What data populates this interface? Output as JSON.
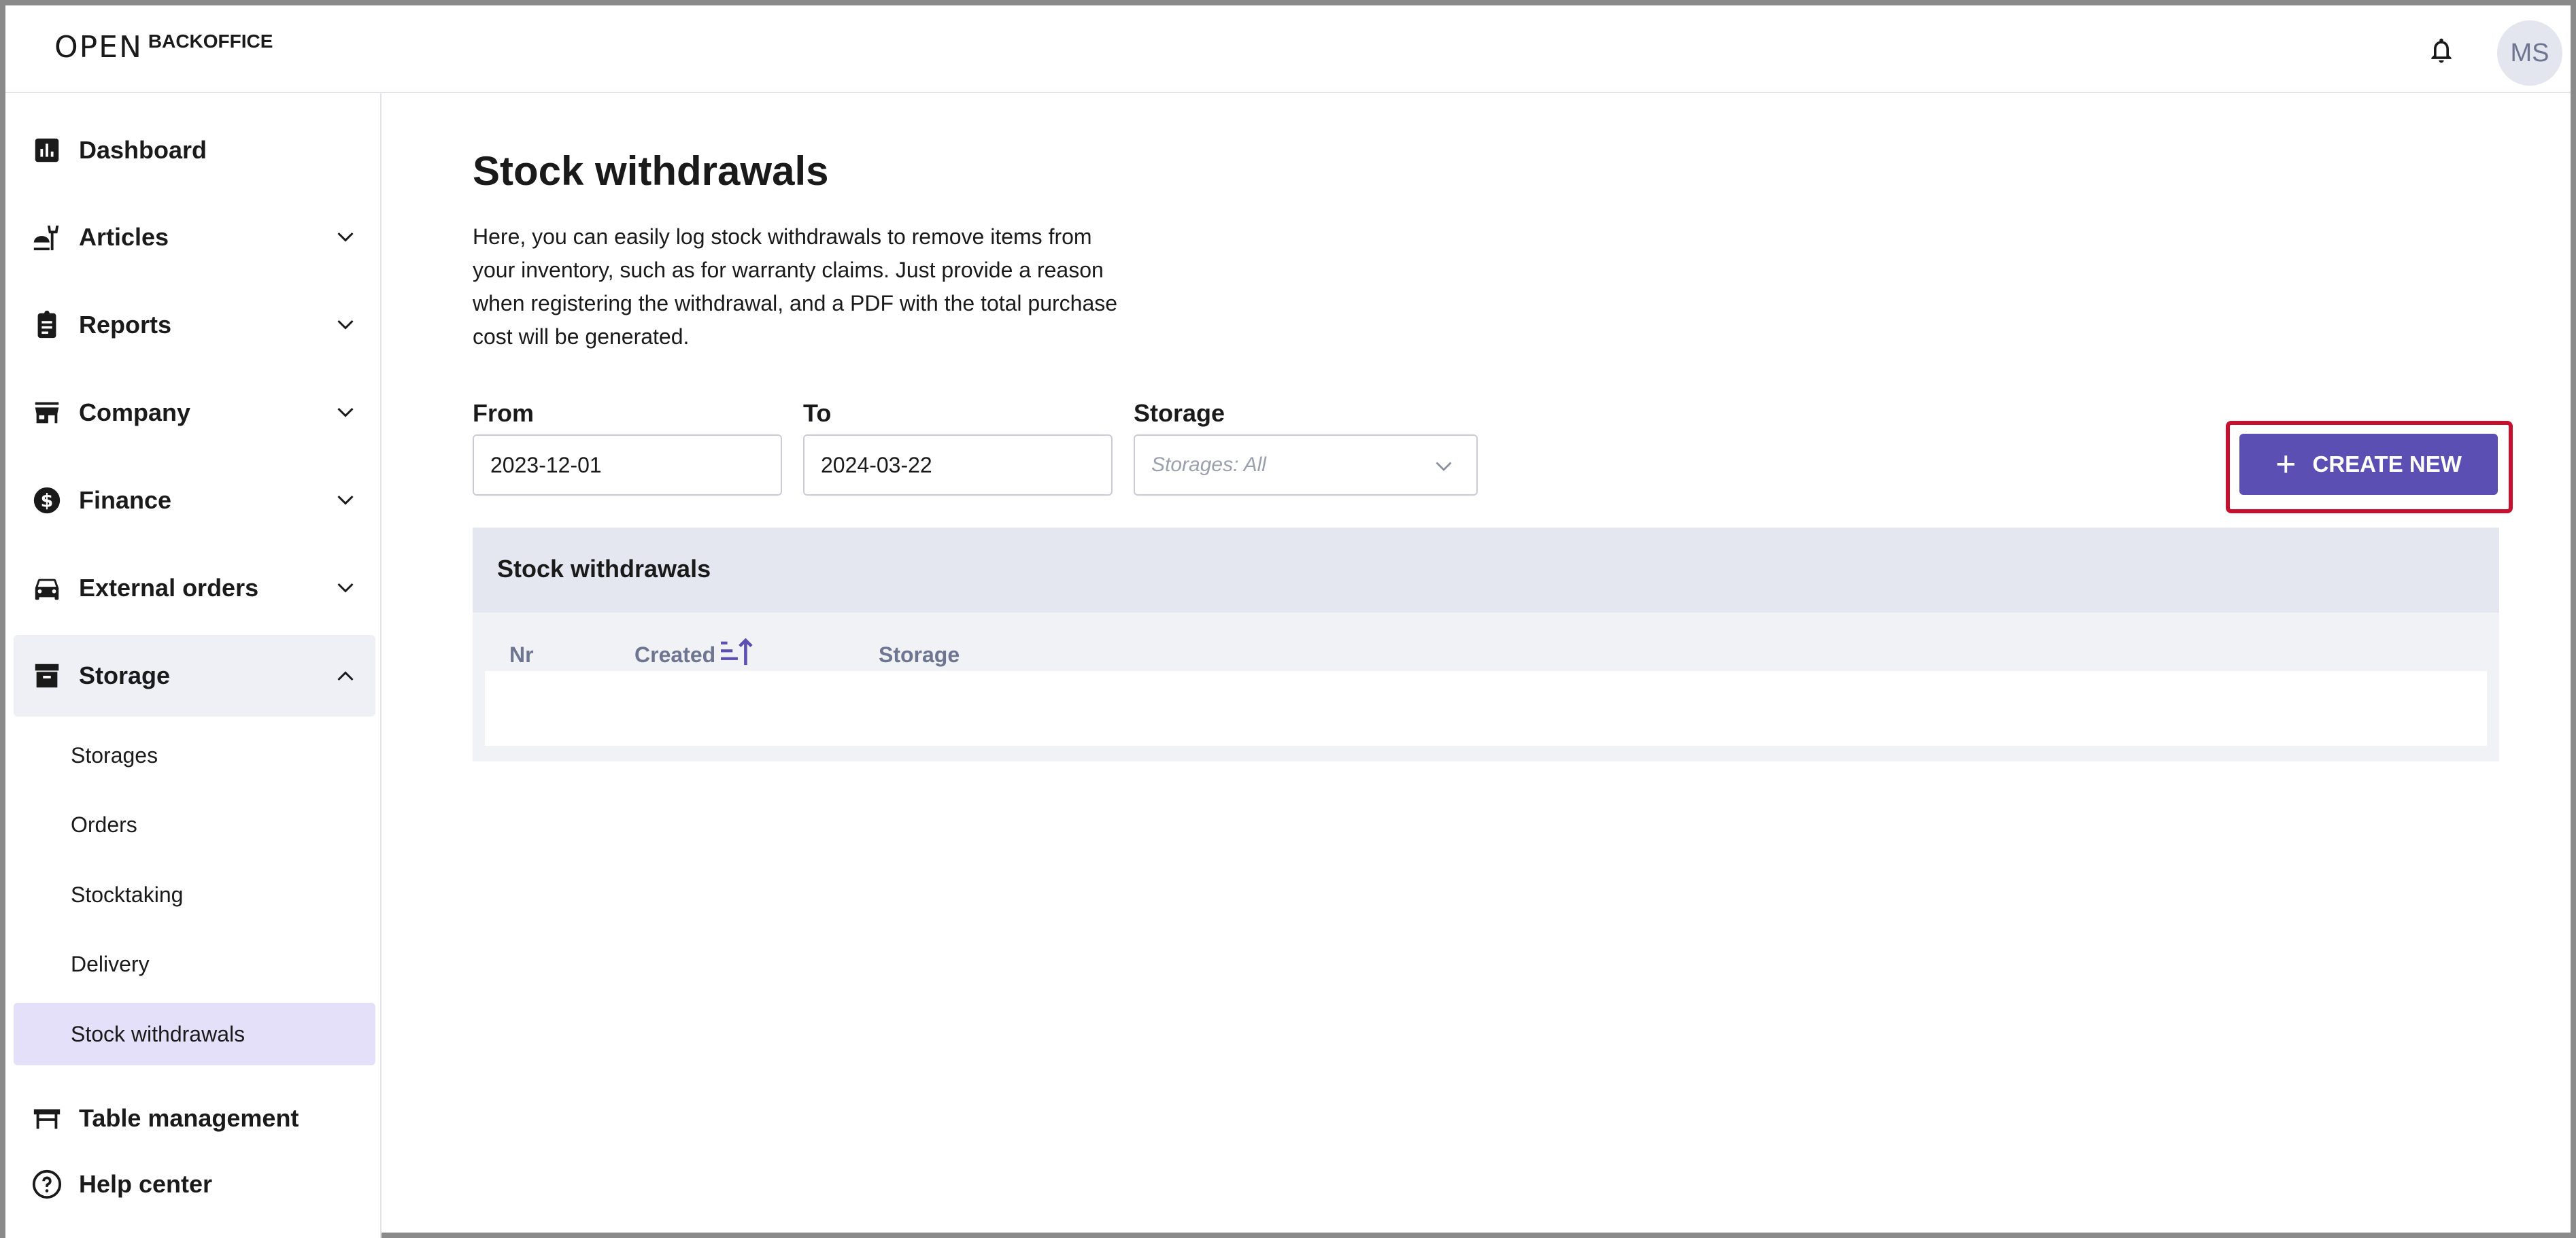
{
  "header": {
    "logo_mark": "OPEN",
    "logo_text": "BACKOFFICE",
    "avatar_initials": "MS"
  },
  "sidebar": {
    "items": [
      {
        "label": "Dashboard",
        "icon": "bar-chart-icon"
      },
      {
        "label": "Articles",
        "icon": "food-icon"
      },
      {
        "label": "Reports",
        "icon": "clipboard-icon"
      },
      {
        "label": "Company",
        "icon": "store-icon"
      },
      {
        "label": "Finance",
        "icon": "dollar-icon"
      },
      {
        "label": "External orders",
        "icon": "car-icon"
      },
      {
        "label": "Storage",
        "icon": "archive-icon"
      }
    ],
    "storage_subitems": [
      "Storages",
      "Orders",
      "Stocktaking",
      "Delivery",
      "Stock withdrawals"
    ],
    "active_subitem": "Stock withdrawals",
    "bottom_items": [
      {
        "label": "Table management",
        "icon": "table-icon"
      },
      {
        "label": "Help center",
        "icon": "help-icon"
      }
    ]
  },
  "main": {
    "title": "Stock withdrawals",
    "description": "Here, you can easily log stock withdrawals to remove items from your inventory, such as for warranty claims. Just provide a reason when registering the withdrawal, and a PDF with the total purchase cost will be generated.",
    "filters": {
      "from_label": "From",
      "from_value": "2023-12-01",
      "to_label": "To",
      "to_value": "2024-03-22",
      "storage_label": "Storage",
      "storage_placeholder": "Storages: All"
    },
    "create_button_label": "CREATE NEW",
    "table": {
      "title": "Stock withdrawals",
      "columns": [
        "Nr",
        "Created",
        "Storage"
      ]
    }
  },
  "colors": {
    "accent": "#5c4fb3",
    "highlight_outline": "#c8102e",
    "active_nav_bg": "#e4e0fa",
    "panel_header_bg": "#e4e7ef"
  }
}
